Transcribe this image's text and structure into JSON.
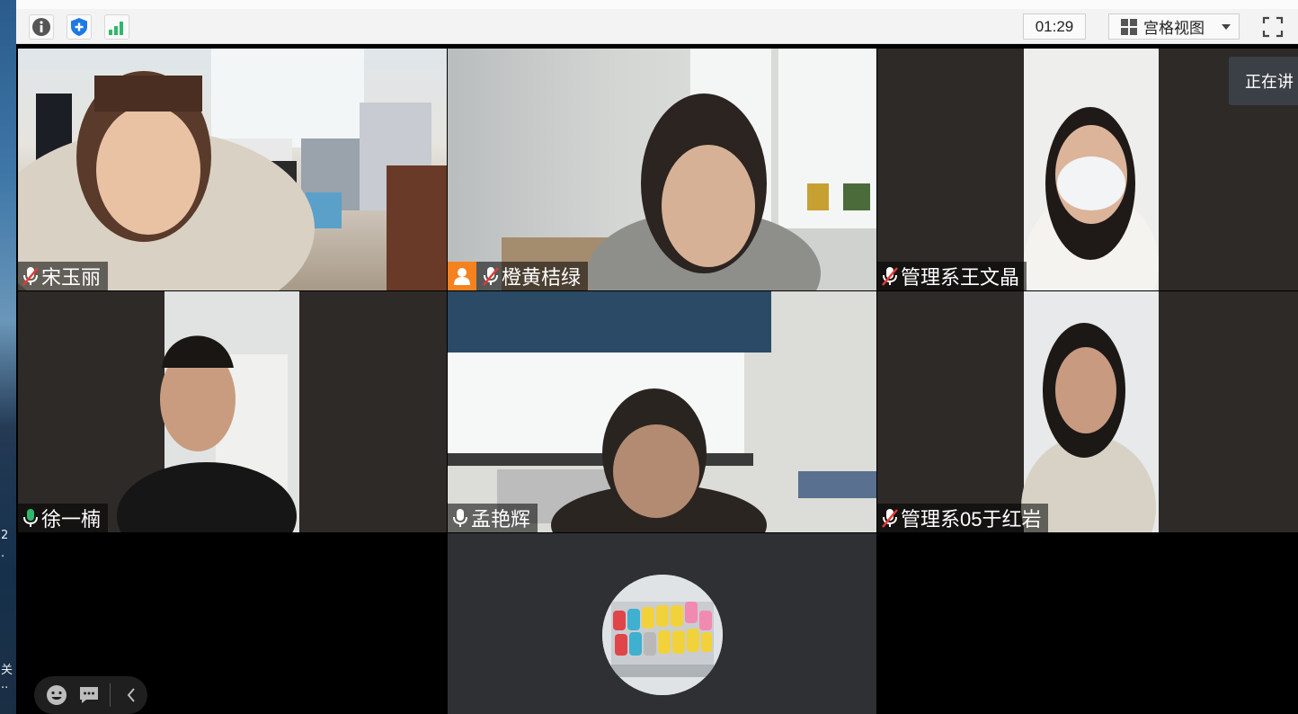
{
  "toolbar": {
    "icons": [
      "info-icon",
      "shield-icon",
      "signal-icon"
    ],
    "timer": "01:29",
    "view_label": "宫格视图",
    "fullscreen_icon": "fullscreen-icon"
  },
  "speaking_tip": "正在讲",
  "desktop_strip": {
    "glyphs": [
      "2",
      "·",
      "关",
      "··"
    ]
  },
  "participants": [
    {
      "name": "宋玉丽",
      "mic": "muted",
      "active": false
    },
    {
      "name": "橙黄桔绿",
      "mic": "muted",
      "active": false,
      "badge": "avatar-icon"
    },
    {
      "name": "管理系王文晶",
      "mic": "muted",
      "active": false
    },
    {
      "name": "徐一楠",
      "mic": "speaking",
      "active": true
    },
    {
      "name": "孟艳辉",
      "mic": "on",
      "active": false
    },
    {
      "name": "管理系05于红岩",
      "mic": "muted",
      "active": false
    }
  ],
  "colors": {
    "accent_green": "#2fb86a",
    "badge_orange": "#f5821f",
    "shield_blue": "#1e78e6"
  },
  "bottom_tools": [
    "emoji-icon",
    "chat-icon",
    "collapse-icon"
  ]
}
